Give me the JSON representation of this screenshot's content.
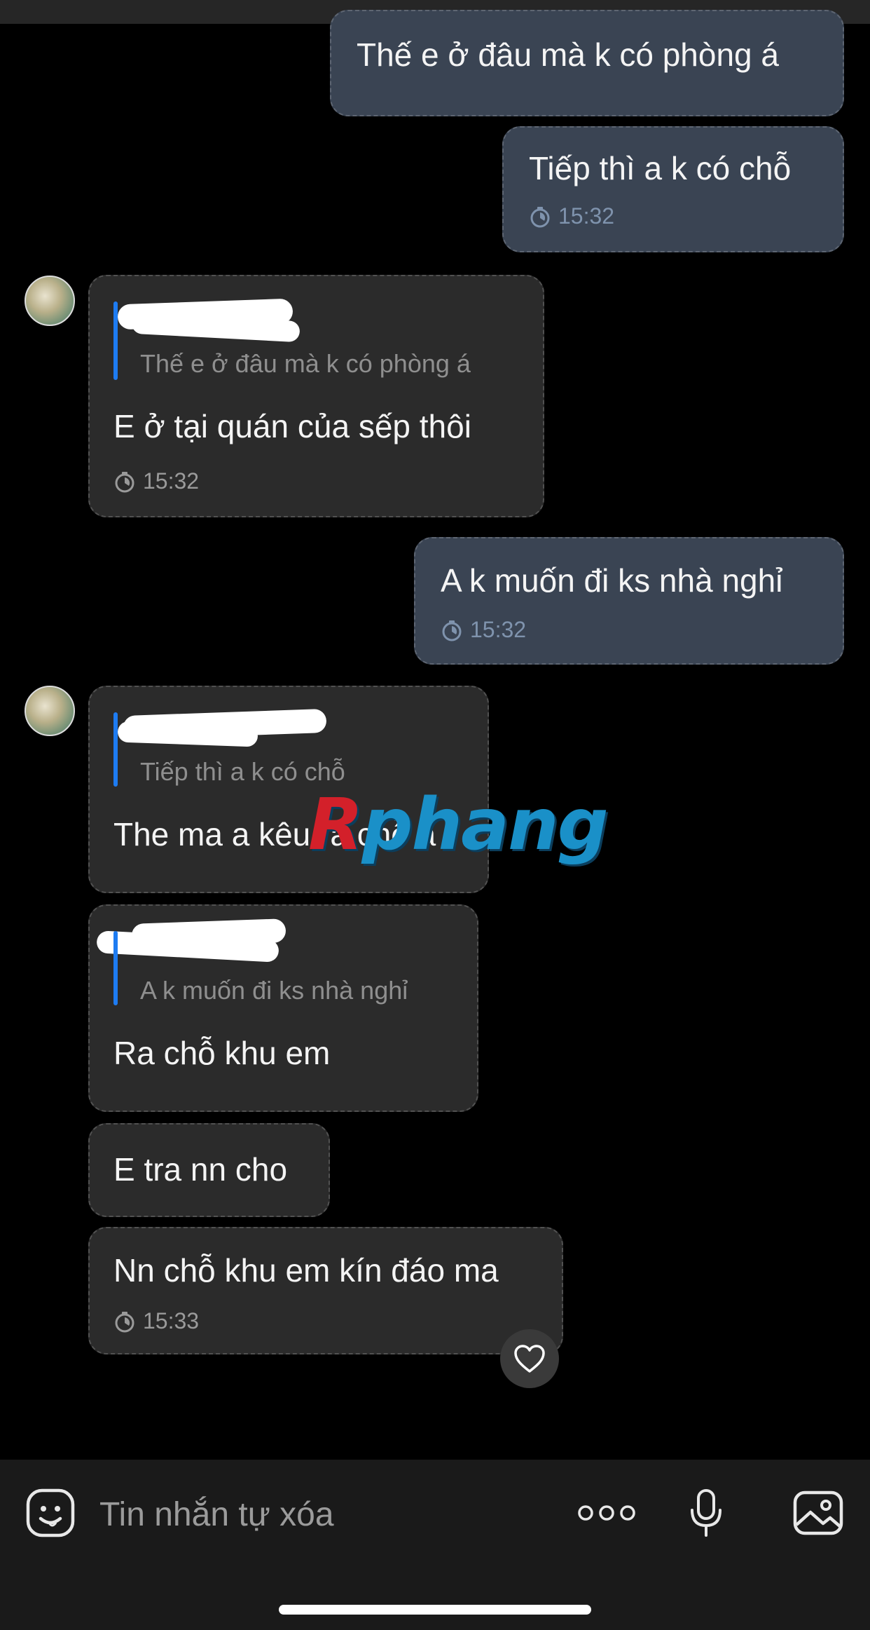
{
  "messages": [
    {
      "id": "m1",
      "direction": "outgoing",
      "text": "Thế e ở đâu mà k có phòng á"
    },
    {
      "id": "m2",
      "direction": "outgoing",
      "text": "Tiếp thì a k có chỗ",
      "time": "15:32"
    },
    {
      "id": "m3",
      "direction": "incoming",
      "quote": "Thế e ở đâu mà k có phòng á",
      "text": "E ở tại quán của sếp thôi",
      "time": "15:32"
    },
    {
      "id": "m4",
      "direction": "outgoing",
      "text": "A k muốn đi ks nhà nghỉ",
      "time": "15:32"
    },
    {
      "id": "m5",
      "direction": "incoming",
      "quote": "Tiếp thì a k có chỗ",
      "text": "The ma a kêu ra chỗ a"
    },
    {
      "id": "m6",
      "direction": "incoming",
      "quote": "A k muốn đi ks nhà nghỉ",
      "text": "Ra chỗ khu em"
    },
    {
      "id": "m7",
      "direction": "incoming",
      "text": "E tra nn cho"
    },
    {
      "id": "m8",
      "direction": "incoming",
      "text": "Nn chỗ khu em kín đáo ma",
      "time": "15:33"
    }
  ],
  "watermark": {
    "first": "R",
    "rest": "phang"
  },
  "composer": {
    "placeholder": "Tin nhắn tự xóa"
  },
  "icons": [
    "timer-icon",
    "heart-icon",
    "sticker-icon",
    "more-icon",
    "microphone-icon",
    "gallery-icon"
  ],
  "colors": {
    "outgoing_bubble": "#3a4453",
    "incoming_bubble": "#2b2b2b",
    "quote_bar": "#1e7cf2"
  }
}
